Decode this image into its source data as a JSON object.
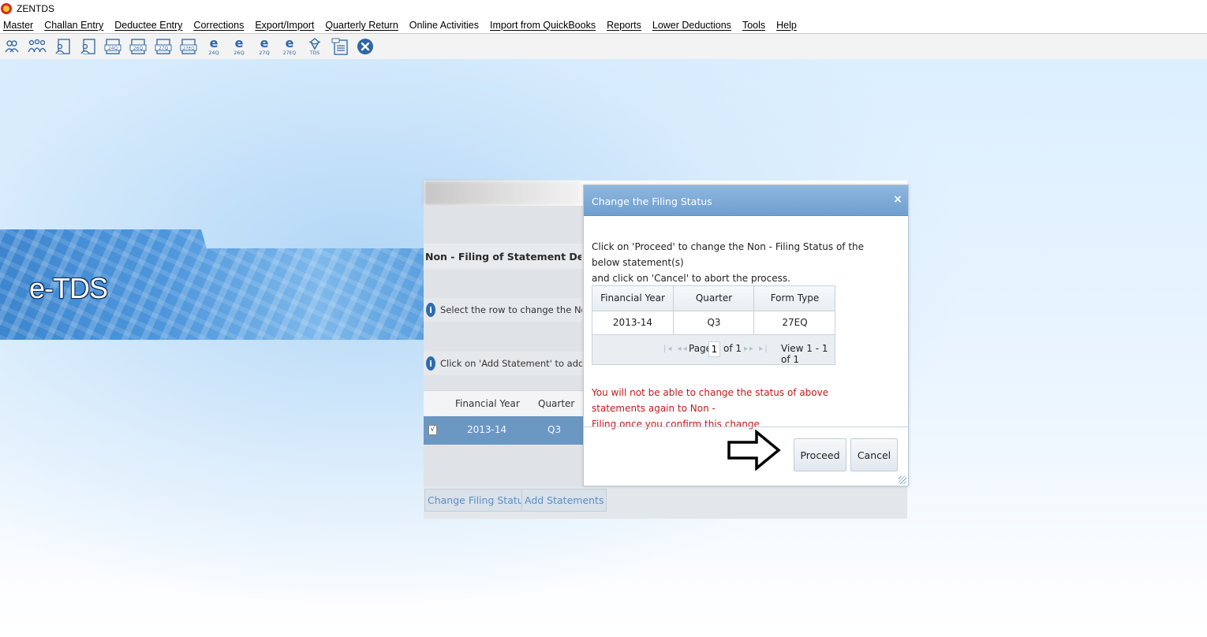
{
  "app": {
    "title": "ZENTDS"
  },
  "menu": [
    {
      "id": "master",
      "label": "Master"
    },
    {
      "id": "challan-entry",
      "label": "Challan Entry"
    },
    {
      "id": "deductee-entry",
      "label": "Deductee Entry"
    },
    {
      "id": "corrections",
      "label": "Corrections"
    },
    {
      "id": "export-import",
      "label": "Export/Import"
    },
    {
      "id": "quarterly-return",
      "label": "Quarterly Return"
    },
    {
      "id": "online-activities",
      "label": "Online Activities"
    },
    {
      "id": "import-quickbooks",
      "label": "Import from QuickBooks"
    },
    {
      "id": "reports",
      "label": "Reports"
    },
    {
      "id": "lower-deductions",
      "label": "Lower Deductions"
    },
    {
      "id": "tools",
      "label": "Tools"
    },
    {
      "id": "help",
      "label": "Help"
    }
  ],
  "toolbar": {
    "form_labels": [
      "24Q",
      "26Q",
      "27Q",
      "27EQ"
    ],
    "eform_labels": [
      "24Q",
      "26Q",
      "27Q",
      "27EQ"
    ],
    "tds_label": "TDS"
  },
  "banner": {
    "title": "e-TDS"
  },
  "background_page": {
    "section_title": "Non - Filing of Statement Details for",
    "info_select": "Select the row to change the Non - Fili",
    "info_add": "Click on 'Add Statement' to add furthe",
    "grid_headers": [
      "Financial Year",
      "Quarter"
    ],
    "grid_row": {
      "checked": "√",
      "year": "2013-14",
      "quarter": "Q3"
    },
    "change_filing_status_label": "Change Filing Status",
    "add_statements_label": "Add Statements"
  },
  "dialog": {
    "title": "Change the Filing Status",
    "close": "×",
    "message_line1": "Click on 'Proceed' to change the Non - Filing Status of the below statement(s)",
    "message_line2": "and click on 'Cancel' to abort the process.",
    "table": {
      "headers": [
        "Financial Year",
        "Quarter",
        "Form Type"
      ],
      "rows": [
        {
          "year": "2013-14",
          "quarter": "Q3",
          "form_type": "27EQ"
        }
      ],
      "pager": {
        "page_label": "Page",
        "page_value": "1",
        "of_label": "of 1",
        "view_label": "View 1 - 1 of 1",
        "first_prev": "|◂ ◂◂",
        "next_last": "▸▸ ▸|"
      }
    },
    "warning_line1": "You will not be able to change the status of above statements again to Non -",
    "warning_line2": "Filing once you confirm this change",
    "proceed_label": "Proceed",
    "cancel_label": "Cancel"
  },
  "colors": {
    "dialog_header": "#7aa8d6",
    "warning_text": "#c11a1a",
    "selected_row": "#6b97c3"
  }
}
